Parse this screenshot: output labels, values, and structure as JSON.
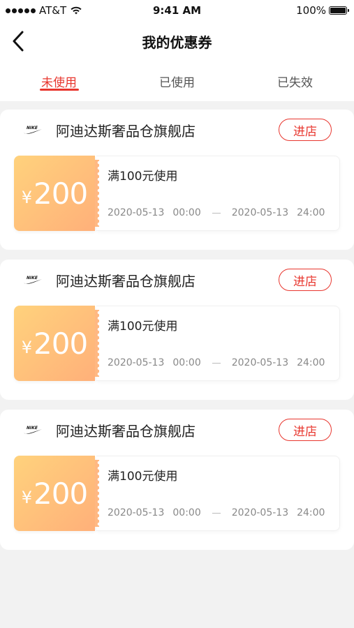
{
  "status_bar": {
    "carrier": "AT&T",
    "time": "9:41 AM",
    "battery": "100%",
    "battery_level": 100
  },
  "nav": {
    "title": "我的优惠券"
  },
  "tabs": [
    {
      "label": "未使用",
      "active": true
    },
    {
      "label": "已使用",
      "active": false
    },
    {
      "label": "已失效",
      "active": false
    }
  ],
  "coupons": [
    {
      "shop_name": "阿迪达斯奢品仓旗舰店",
      "logo_icon": "nike-swoosh-icon",
      "enter_label": "进店",
      "currency": "¥",
      "amount": "200",
      "condition": "满100元使用",
      "start_date": "2020-05-13",
      "start_time": "00:00",
      "end_date": "2020-05-13",
      "end_time": "24:00"
    },
    {
      "shop_name": "阿迪达斯奢品仓旗舰店",
      "logo_icon": "nike-swoosh-icon",
      "enter_label": "进店",
      "currency": "¥",
      "amount": "200",
      "condition": "满100元使用",
      "start_date": "2020-05-13",
      "start_time": "00:00",
      "end_date": "2020-05-13",
      "end_time": "24:00"
    },
    {
      "shop_name": "阿迪达斯奢品仓旗舰店",
      "logo_icon": "nike-swoosh-icon",
      "enter_label": "进店",
      "currency": "¥",
      "amount": "200",
      "condition": "满100元使用",
      "start_date": "2020-05-13",
      "start_time": "00:00",
      "end_date": "2020-05-13",
      "end_time": "24:00"
    }
  ],
  "colors": {
    "accent": "#e8362e",
    "coupon_gradient_start": "#ffd27c",
    "coupon_gradient_end": "#ffb07a",
    "background": "#f2f2f2"
  }
}
